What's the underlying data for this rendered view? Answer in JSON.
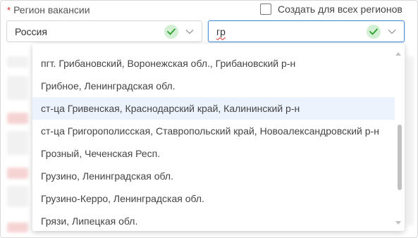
{
  "form": {
    "required_mark": "*",
    "region_label": "Регион вакансии",
    "all_regions_checkbox_label": "Создать для всех регионов",
    "country_value": "Россия",
    "region_query": "гр"
  },
  "dropdown": {
    "options": [
      "пгт. Грибановский, Воронежская обл., Грибановский р-н",
      "Грибное, Ленинградская обл.",
      "ст-ца Гривенская, Краснодарский край, Калининский р-н",
      "ст-ца Григорополисская, Ставропольский край, Новоалександровский р-н",
      "Грозный, Чеченская Респ.",
      "Грузино, Ленинградская обл.",
      "Грузино-Керро, Ленинградская обл.",
      "Грязи, Липецкая обл."
    ],
    "highlighted_index": 2
  },
  "colors": {
    "required": "#e02424",
    "focus_border": "#4a90d9",
    "valid_badge_bg": "#d4f0d4",
    "valid_check": "#2e9e2e",
    "highlight_bg": "#edf3fc"
  },
  "icons": {
    "valid": "check-circle-icon",
    "dropdown": "chevron-down-icon"
  }
}
